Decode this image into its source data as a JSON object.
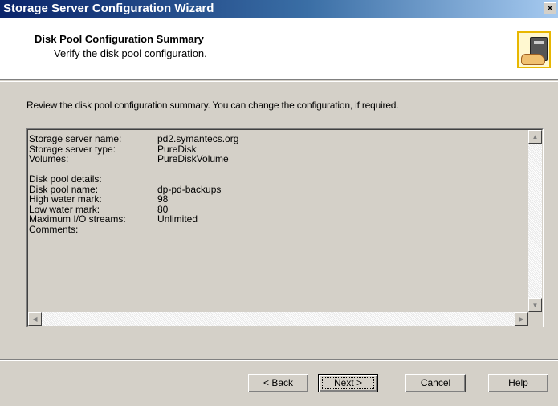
{
  "window": {
    "title": "Storage Server Configuration Wizard",
    "close_label": "×"
  },
  "header": {
    "title": "Disk Pool Configuration Summary",
    "subtitle": "Verify the disk pool configuration."
  },
  "instruction": "Review the disk pool configuration summary. You can change the configuration, if required.",
  "summary": {
    "server_rows": [
      {
        "key": "Storage server name:",
        "value": "pd2.symantecs.org"
      },
      {
        "key": "Storage server type:",
        "value": "PureDisk"
      },
      {
        "key": "Volumes:",
        "value": "PureDiskVolume"
      }
    ],
    "pool_heading": "Disk pool details:",
    "pool_rows": [
      {
        "key": "Disk pool name:",
        "value": "dp-pd-backups"
      },
      {
        "key": "High water mark:",
        "value": "98"
      },
      {
        "key": "Low water mark:",
        "value": "80"
      },
      {
        "key": "Maximum I/O streams:",
        "value": "Unlimited"
      },
      {
        "key": "Comments:",
        "value": ""
      }
    ]
  },
  "buttons": {
    "back": "< Back",
    "next": "Next >",
    "cancel": "Cancel",
    "help": "Help"
  },
  "icons": {
    "header": "storage-server-icon",
    "scroll_up": "▲",
    "scroll_down": "▼",
    "scroll_left": "◀",
    "scroll_right": "▶"
  }
}
